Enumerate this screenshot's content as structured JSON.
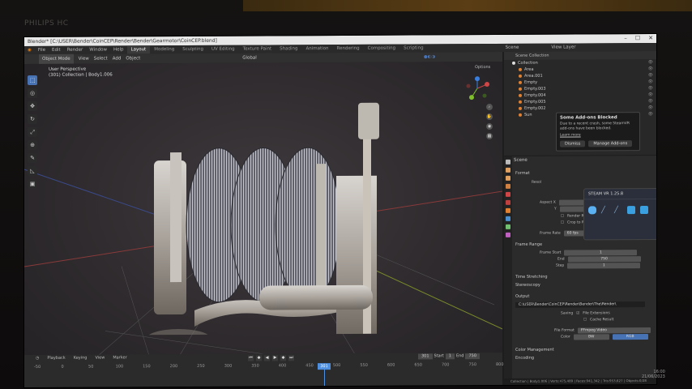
{
  "bezel": {
    "logo": "PHILIPS HC"
  },
  "window": {
    "title": "Blender* [C:\\USER\\Bender\\CoinCEP\\Render\\Bender\\Gearmotor\\CoinCEP.blend]",
    "controls": [
      "–",
      "☐",
      "✕"
    ]
  },
  "menu": {
    "items": [
      "File",
      "Edit",
      "Render",
      "Window",
      "Help"
    ],
    "workspaces": [
      "Layout",
      "Modeling",
      "Sculpting",
      "UV Editing",
      "Texture Paint",
      "Shading",
      "Animation",
      "Rendering",
      "Compositing",
      "Scripting"
    ],
    "active_workspace": "Layout",
    "scene_label": "Scene",
    "view_layer_label": "View Layer"
  },
  "viewport": {
    "mode": "Object Mode",
    "header_items": [
      "View",
      "Select",
      "Add",
      "Object"
    ],
    "transform": "Global",
    "perspective": "User Perspective",
    "collection_info": "(301) Collection | Body1.006",
    "options_label": "Options"
  },
  "toolbar": {
    "tools": [
      {
        "icon": "select-box-icon",
        "glyph": "⬚"
      },
      {
        "icon": "cursor-icon",
        "glyph": "◎"
      },
      {
        "icon": "move-icon",
        "glyph": "✥"
      },
      {
        "icon": "rotate-icon",
        "glyph": "↻"
      },
      {
        "icon": "scale-icon",
        "glyph": "⤢"
      },
      {
        "icon": "transform-icon",
        "glyph": "⊕"
      },
      {
        "icon": "annotate-icon",
        "glyph": "✎"
      },
      {
        "icon": "measure-icon",
        "glyph": "◺"
      },
      {
        "icon": "add-cube-icon",
        "glyph": "▣"
      }
    ]
  },
  "timeline": {
    "menu": [
      "Playback",
      "Keying",
      "View",
      "Marker"
    ],
    "start_label": "Start",
    "start": "1",
    "end_label": "End",
    "end": "750",
    "current_frame": "301",
    "ruler": [
      "-50",
      "0",
      "50",
      "100",
      "150",
      "200",
      "250",
      "300",
      "350",
      "400",
      "450",
      "500",
      "550",
      "600",
      "650",
      "700",
      "750",
      "800"
    ]
  },
  "outliner": {
    "title": "Scene Collection",
    "items": [
      "Collection",
      "Area",
      "Area.001",
      "Empty",
      "Empty.003",
      "Empty.004",
      "Empty.005",
      "Empty.002",
      "Sun"
    ]
  },
  "notification": {
    "title": "Some Add-ons Blocked",
    "body": "Due to a recent crash, some SteamVR add-ons have been blocked.",
    "link": "Learn more",
    "dismiss": "Dismiss",
    "manage": "Manage Add-ons"
  },
  "steam_popup": {
    "title": "STEAM VR 1.25.8"
  },
  "properties": {
    "header": "Scene",
    "sections": {
      "format": "Format",
      "resolution_label": "Resol",
      "aspect_x_label": "Aspect X",
      "aspect_x": "1.000",
      "aspect_y_label": "Y",
      "aspect_y": "1.000",
      "render_region": "Render Region",
      "crop": "Crop to Render Region",
      "frame_rate_label": "Frame Rate",
      "frame_rate": "60 fps",
      "frame_range": "Frame Range",
      "frame_start_label": "Frame Start",
      "frame_start": "1",
      "end_label": "End",
      "end": "750",
      "step_label": "Step",
      "step": "1",
      "time_stretching": "Time Stretching",
      "stereoscopy": "Stereoscopy",
      "output": "Output",
      "output_path": "C:\\USER\\Bender\\CoinCEP\\Render\\Bender\\The\\Render\\",
      "saving_label": "Saving",
      "file_extensions": "File Extensions",
      "cache_result": "Cache Result",
      "file_format_label": "File Format",
      "file_format": "FFmpeg Video",
      "color_label": "Color",
      "color_bw": "BW",
      "color_rgb": "RGB",
      "color_management": "Color Management",
      "encoding": "Encoding"
    }
  },
  "status": {
    "text": "Collection | Body1.006 | Verts:475,489 | Faces:941,342 | Tris:953,627 | Objects:0/28"
  },
  "clock": {
    "time": "16:00",
    "date": "21/06/2023"
  },
  "colors": {
    "accent": "#4772b3",
    "playhead": "#4f8fe0",
    "outliner_object": "#e08030"
  }
}
